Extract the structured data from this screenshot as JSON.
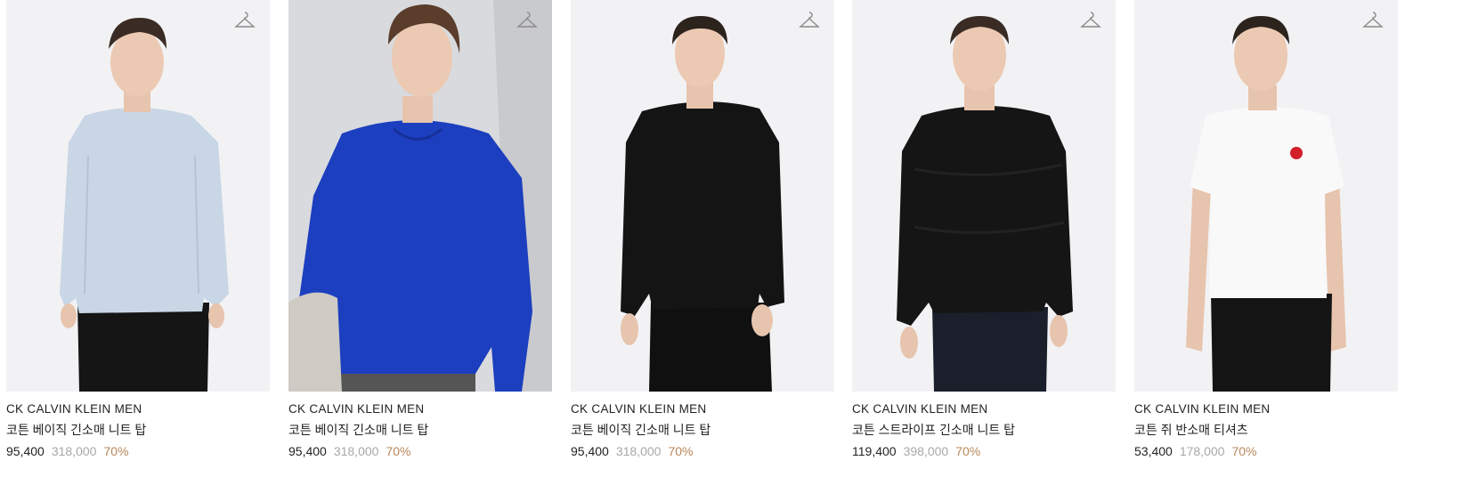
{
  "products": [
    {
      "brand": "CK CALVIN KLEIN MEN",
      "name": "코튼 베이직 긴소매 니트 탑",
      "sale_price": "95,400",
      "original_price": "318,000",
      "discount": "70%",
      "garment_color": "#c7d4e3",
      "background_color": "#f2f2f4",
      "model_image": "model-light-blue-sweater"
    },
    {
      "brand": "CK CALVIN KLEIN MEN",
      "name": "코튼 베이직 긴소매 니트 탑",
      "sale_price": "95,400",
      "original_price": "318,000",
      "discount": "70%",
      "garment_color": "#1c3fbf",
      "background_color": "#d9dadd",
      "model_image": "model-cobalt-blue-sweater"
    },
    {
      "brand": "CK CALVIN KLEIN MEN",
      "name": "코튼 베이직 긴소매 니트 탑",
      "sale_price": "95,400",
      "original_price": "318,000",
      "discount": "70%",
      "garment_color": "#141414",
      "background_color": "#f2f2f4",
      "model_image": "model-black-sweater"
    },
    {
      "brand": "CK CALVIN KLEIN MEN",
      "name": "코튼 스트라이프 긴소매 니트 탑",
      "sale_price": "119,400",
      "original_price": "398,000",
      "discount": "70%",
      "garment_color": "#151515",
      "background_color": "#f2f2f4",
      "model_image": "model-black-stripe-sweater"
    },
    {
      "brand": "CK CALVIN KLEIN MEN",
      "name": "코튼 쥐 반소매 티셔츠",
      "sale_price": "53,400",
      "original_price": "178,000",
      "discount": "70%",
      "garment_color": "#f7f7f8",
      "background_color": "#f2f2f4",
      "model_image": "model-white-tshirt"
    }
  ],
  "icons": {
    "wishlist": "hanger-icon"
  },
  "colors": {
    "text": "#222222",
    "original_price": "#a8a8a8",
    "discount": "#b8875a"
  }
}
